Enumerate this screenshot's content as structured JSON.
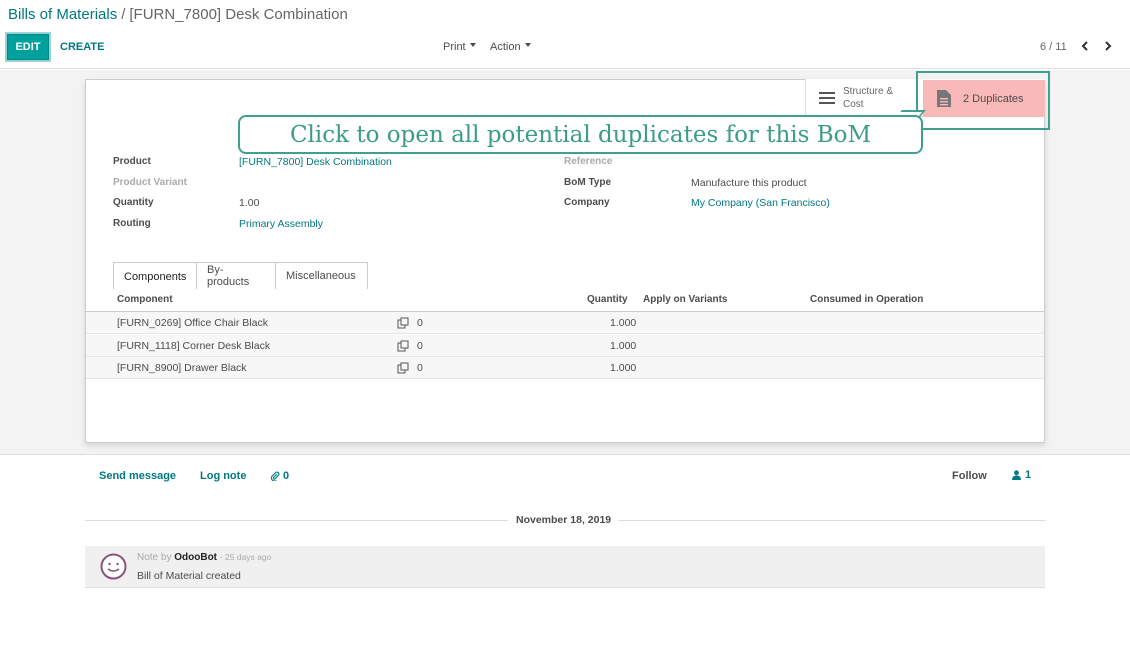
{
  "breadcrumb": {
    "parent": "Bills of Materials",
    "separator": "/",
    "current": "[FURN_7800] Desk Combination"
  },
  "toolbar": {
    "edit_label": "EDIT",
    "create_label": "CREATE",
    "print_label": "Print",
    "action_label": "Action"
  },
  "pager": {
    "text": "6 / 11"
  },
  "stat_buttons": {
    "structure_label_1": "Structure &",
    "structure_label_2": "Cost",
    "duplicates_label": "2 Duplicates"
  },
  "tooltip": {
    "text": "Click to open all potential duplicates for this BoM"
  },
  "form": {
    "product_label": "Product",
    "product_value": "[FURN_7800] Desk Combination",
    "variant_label": "Product Variant",
    "quantity_label": "Quantity",
    "quantity_value": "1.00",
    "routing_label": "Routing",
    "routing_value": "Primary Assembly",
    "reference_label": "Reference",
    "bom_type_label": "BoM Type",
    "bom_type_value": "Manufacture this product",
    "company_label": "Company",
    "company_value": "My Company (San Francisco)"
  },
  "tabs": [
    {
      "label": "Components",
      "active": true
    },
    {
      "label": "By-products",
      "active": false
    },
    {
      "label": "Miscellaneous",
      "active": false
    }
  ],
  "table": {
    "headers": {
      "component": "Component",
      "quantity": "Quantity",
      "variants": "Apply on Variants",
      "operation": "Consumed in Operation"
    },
    "rows": [
      {
        "component": "[FURN_0269] Office Chair Black",
        "count": "0",
        "quantity": "1.000"
      },
      {
        "component": "[FURN_1118] Corner Desk Black",
        "count": "0",
        "quantity": "1.000"
      },
      {
        "component": "[FURN_8900] Drawer Black",
        "count": "0",
        "quantity": "1.000"
      }
    ]
  },
  "chatter": {
    "send_message": "Send message",
    "log_note": "Log note",
    "attachments": "0",
    "follow": "Follow",
    "followers": "1",
    "date": "November 18, 2019",
    "message": {
      "prefix": "Note by",
      "author": "OdooBot",
      "ago": "- 25 days ago",
      "body": "Bill of Material created"
    }
  },
  "colors": {
    "brand": "#00a09d",
    "link": "#00787f",
    "duplicate_bg": "#f9b9b9",
    "highlight": "#3fa08f"
  }
}
